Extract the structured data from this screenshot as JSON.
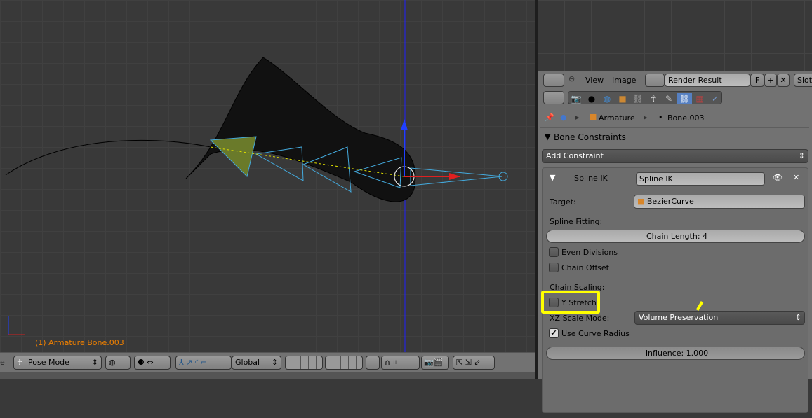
{
  "viewport": {
    "status_text": "(1) Armature Bone.003",
    "axis_color": "#2020ff"
  },
  "bottom_toolbar": {
    "mode": "Pose Mode",
    "orientation": "Global",
    "left_cut": "e"
  },
  "image_header": {
    "menu_view": "View",
    "menu_image": "Image",
    "image_name": "Render Result",
    "fake_user": "F",
    "slot": "Slot"
  },
  "properties": {
    "tabs": [
      "render",
      "scene",
      "world",
      "object",
      "constraints",
      "data",
      "bone",
      "bone-constraints",
      "texture",
      "physics"
    ],
    "active_tab": "bone-constraints",
    "breadcrumb": [
      "Armature",
      "Bone.003"
    ],
    "panel_title": "Bone Constraints",
    "add_constraint": "Add Constraint",
    "constraint": {
      "type": "Spline IK",
      "name": "Spline IK",
      "target_label": "Target:",
      "target_value": "BezierCurve",
      "spline_fitting_label": "Spline Fitting:",
      "chain_length": "Chain Length: 4",
      "even_divisions": {
        "label": "Even Divisions",
        "checked": false
      },
      "chain_offset": {
        "label": "Chain Offset",
        "checked": false
      },
      "chain_scaling_label": "Chain Scaling:",
      "y_stretch": {
        "label": "Y Stretch",
        "checked": false
      },
      "xz_scale_mode_label": "XZ Scale Mode:",
      "xz_scale_mode": "Volume Preservation",
      "use_curve_radius": {
        "label": "Use Curve Radius",
        "checked": true
      },
      "influence": "Influence: 1.000"
    }
  },
  "highlight_color": "#ffff00"
}
